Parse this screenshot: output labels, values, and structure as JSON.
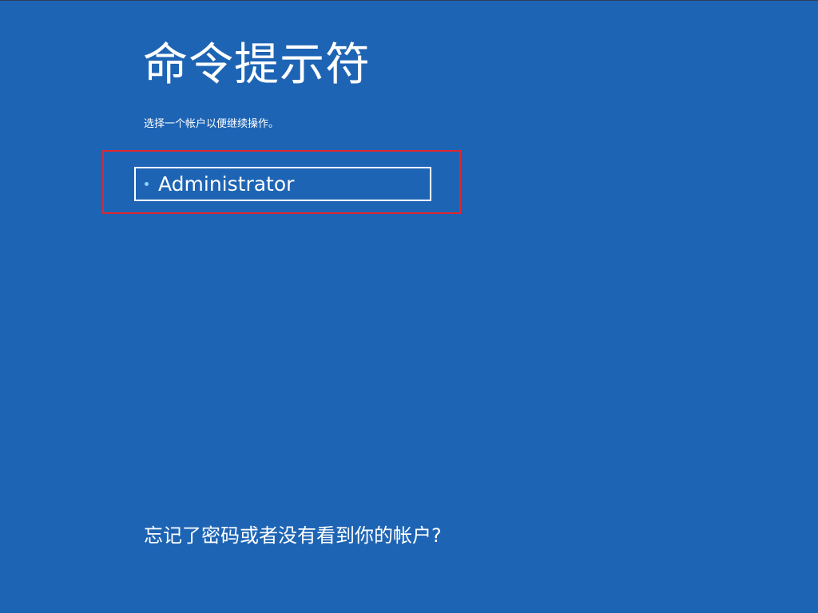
{
  "screen": {
    "title": "命令提示符",
    "subtitle": "选择一个帐户以便继续操作。"
  },
  "accounts": [
    {
      "name": "Administrator",
      "icon": "bullet-dot"
    }
  ],
  "footer": {
    "forgot_link": "忘记了密码或者没有看到你的帐户?"
  },
  "colors": {
    "background": "#1e64b4",
    "text": "#ffffff",
    "highlight_frame": "#e0262f",
    "bullet": "#8fd0ff"
  }
}
